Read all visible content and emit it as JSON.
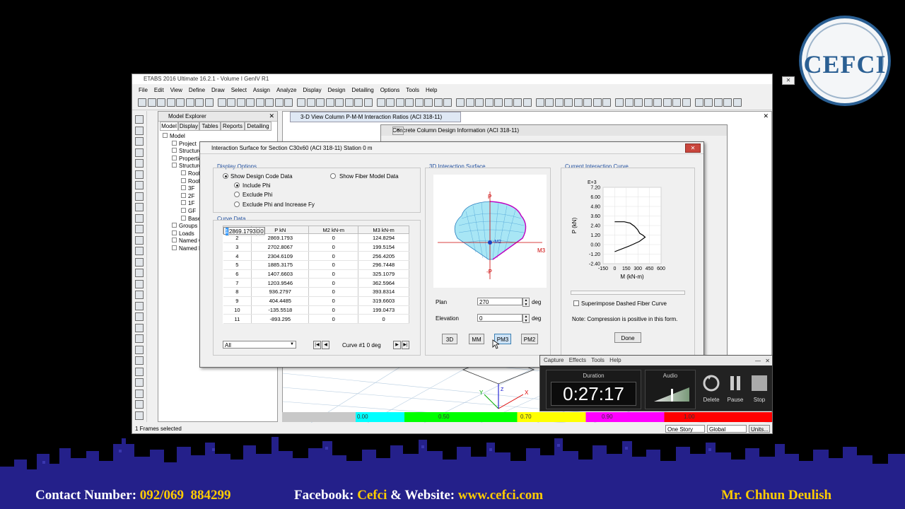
{
  "logo": {
    "text": "CEFCI"
  },
  "window": {
    "title": "ETABS 2016 Ultimate 16.2.1 - Volume I GenIV R1",
    "menu": [
      "File",
      "Edit",
      "View",
      "Define",
      "Draw",
      "Select",
      "Assign",
      "Analyze",
      "Display",
      "Design",
      "Detailing",
      "Options",
      "Tools",
      "Help"
    ],
    "status": "1 Frames selected",
    "status_right": {
      "story": "One Story",
      "coord": "Global",
      "units": "Units..."
    }
  },
  "explorer": {
    "title": "Model Explorer",
    "tabs": [
      "Model",
      "Display",
      "Tables",
      "Reports",
      "Detailing"
    ],
    "tree": [
      {
        "label": "Model",
        "level": 0
      },
      {
        "label": "Project",
        "level": 1
      },
      {
        "label": "Structure",
        "level": 1
      },
      {
        "label": "Properties",
        "level": 1
      },
      {
        "label": "Structure",
        "level": 1
      },
      {
        "label": "Roof",
        "level": 2
      },
      {
        "label": "Roof",
        "level": 2
      },
      {
        "label": "3F",
        "level": 2
      },
      {
        "label": "2F",
        "level": 2
      },
      {
        "label": "1F",
        "level": 2
      },
      {
        "label": "GF",
        "level": 2
      },
      {
        "label": "Base",
        "level": 2
      },
      {
        "label": "Groups",
        "level": 1
      },
      {
        "label": "Loads",
        "level": 1
      },
      {
        "label": "Named O",
        "level": 1
      },
      {
        "label": "Named P",
        "level": 1
      }
    ]
  },
  "view": {
    "tab_title": "3-D View  Column P-M-M Interaction Ratios  (ACI 318-11)",
    "colorbar_ticks": [
      "0.00",
      "0.50",
      "0.70",
      "0.90",
      "1.00"
    ],
    "axes": {
      "x": "X",
      "y": "Y",
      "z": "Z"
    }
  },
  "concrete_dialog": {
    "title": "Concrete Column Design Information (ACI 318-11)"
  },
  "dialog": {
    "title": "Interaction Surface for Section C30x60 (ACI 318-11)  Station 0 m",
    "display_options": {
      "label": "Display Options",
      "show_code": "Show Design Code Data",
      "show_fiber": "Show Fiber Model Data",
      "include_phi": "Include Phi",
      "exclude_phi": "Exclude Phi",
      "exclude_phi_fy": "Exclude Phi and Increase Fy"
    },
    "curve_data": {
      "label": "Curve Data",
      "headers": [
        "Point",
        "P  kN",
        "M2  kN-m",
        "M3  kN-m"
      ],
      "rows": [
        [
          "1",
          "2869.1793",
          "0",
          "0"
        ],
        [
          "2",
          "2869.1793",
          "0",
          "124.8294"
        ],
        [
          "3",
          "2702.8067",
          "0",
          "199.5154"
        ],
        [
          "4",
          "2304.6109",
          "0",
          "256.4205"
        ],
        [
          "5",
          "1885.3175",
          "0",
          "296.7448"
        ],
        [
          "6",
          "1407.6603",
          "0",
          "325.1079"
        ],
        [
          "7",
          "1203.9546",
          "0",
          "362.5964"
        ],
        [
          "8",
          "936.2797",
          "0",
          "393.8314"
        ],
        [
          "9",
          "404.4485",
          "0",
          "319.6603"
        ],
        [
          "10",
          "-135.5518",
          "0",
          "199.0473"
        ],
        [
          "11",
          "-893.295",
          "0",
          "0"
        ]
      ],
      "filter": "All",
      "curve_label": "Curve #1  0 deg"
    },
    "surface": {
      "label": "3D Interaction Surface",
      "labels": {
        "p_top": "P",
        "p_bottom": "-P",
        "m3_left": "M3",
        "m3_right": "M3",
        "m2": "M2",
        "m2b": "-M2"
      },
      "plan_label": "Plan",
      "plan_value": "270",
      "elev_label": "Elevation",
      "elev_value": "0",
      "deg": "deg",
      "buttons": [
        "3D",
        "MM",
        "PM3",
        "PM2"
      ]
    },
    "current_curve": {
      "label": "Current Interaction Curve",
      "superimpose": "Superimpose Dashed Fiber Curve",
      "note": "Note:  Compression is positive in this form.",
      "done": "Done"
    }
  },
  "chart_data": {
    "type": "line",
    "xlabel": "M (kN-m)",
    "ylabel": "P (kN)",
    "y_exponent": "E+3",
    "xlim": [
      -150,
      600
    ],
    "ylim": [
      -2.4,
      7.2
    ],
    "xticks": [
      "-150",
      "0",
      "150",
      "300",
      "450",
      "600"
    ],
    "yticks": [
      "7.20",
      "6.00",
      "4.80",
      "3.60",
      "2.40",
      "1.20",
      "0.00",
      "-1.20",
      "-2.40"
    ],
    "series": [
      {
        "x": [
          0,
          124.8294,
          199.5154,
          256.4205,
          296.7448,
          325.1079,
          362.5964,
          393.8314,
          319.6603,
          199.0473,
          0
        ],
        "y": [
          2.8692,
          2.8692,
          2.7028,
          2.3046,
          1.8853,
          1.4077,
          1.204,
          0.9363,
          0.4044,
          -0.1356,
          -0.8933
        ]
      }
    ]
  },
  "recorder": {
    "menu": [
      "Capture",
      "Effects",
      "Tools",
      "Help"
    ],
    "duration_label": "Duration",
    "duration": "0:27:17",
    "audio_label": "Audio",
    "buttons": [
      "Delete",
      "Pause",
      "Stop"
    ]
  },
  "footer": {
    "contact_label": "Contact Number",
    "contact": "092/069  884299",
    "fb_label": "Facebook",
    "fb": "Cefci",
    "web_label": "& Website",
    "web": "www.cefci.com",
    "author": "Mr. Chhun Deulish"
  }
}
